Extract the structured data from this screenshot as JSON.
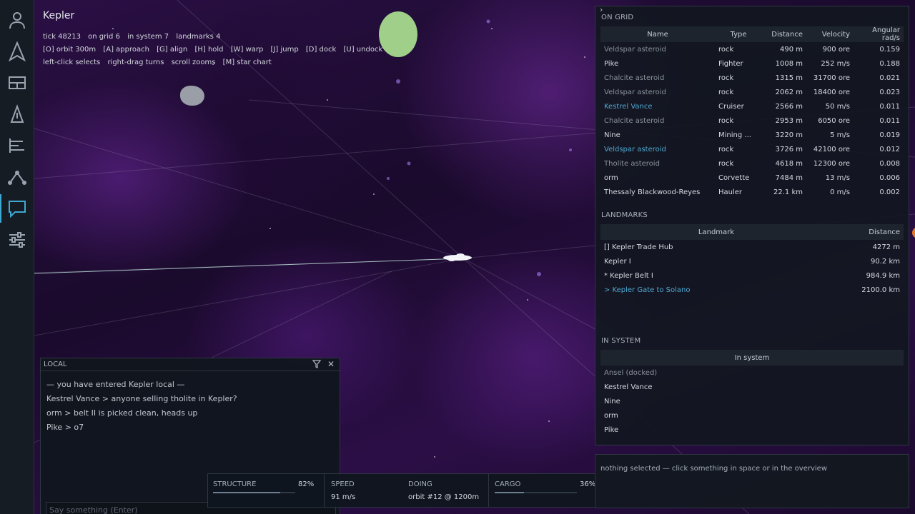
{
  "hud": {
    "title": "Kepler",
    "stats": [
      "tick 48213",
      "on grid 6",
      "in system 7",
      "landmarks 4"
    ],
    "hotkeys": [
      "[O] orbit 300m",
      "[A] approach",
      "[G] align",
      "[H] hold",
      "[W] warp",
      "[J] jump",
      "[D] dock",
      "[U] undock"
    ],
    "help": [
      "left-click selects",
      "right-drag turns",
      "scroll zooms",
      "[M] star chart"
    ]
  },
  "nav": {
    "items": [
      {
        "icon": "character-icon",
        "active": false
      },
      {
        "icon": "ship-icon",
        "active": false
      },
      {
        "icon": "inventory-icon",
        "active": false
      },
      {
        "icon": "fitting-icon",
        "active": false
      },
      {
        "icon": "overview-icon",
        "active": false
      },
      {
        "icon": "map-icon",
        "active": false
      },
      {
        "icon": "chat-icon",
        "active": true
      },
      {
        "icon": "settings-icon",
        "active": false
      }
    ],
    "accent": "#3fa8d0"
  },
  "overview": {
    "chevron": "›",
    "on_grid": {
      "title": "ON GRID",
      "columns": [
        "Name",
        "Type",
        "Distance",
        "Velocity",
        "Angular rad/s"
      ],
      "rows": [
        {
          "name": "Veldspar asteroid",
          "type": "rock",
          "distance": "490 m",
          "velocity": "900 ore",
          "angular": "0.159",
          "style": "dim"
        },
        {
          "name": "Pike",
          "type": "Fighter",
          "distance": "1008 m",
          "velocity": "252 m/s",
          "angular": "0.188",
          "style": ""
        },
        {
          "name": "Chalcite asteroid",
          "type": "rock",
          "distance": "1315 m",
          "velocity": "31700 ore",
          "angular": "0.021",
          "style": "dim"
        },
        {
          "name": "Veldspar asteroid",
          "type": "rock",
          "distance": "2062 m",
          "velocity": "18400 ore",
          "angular": "0.023",
          "style": "dim"
        },
        {
          "name": "Kestrel Vance",
          "type": "Cruiser",
          "distance": "2566 m",
          "velocity": "50 m/s",
          "angular": "0.011",
          "style": "hl"
        },
        {
          "name": "Chalcite asteroid",
          "type": "rock",
          "distance": "2953 m",
          "velocity": "6050 ore",
          "angular": "0.011",
          "style": "dim"
        },
        {
          "name": "Nine",
          "type": "Mining ...",
          "distance": "3220 m",
          "velocity": "5 m/s",
          "angular": "0.019",
          "style": ""
        },
        {
          "name": "Veldspar asteroid",
          "type": "rock",
          "distance": "3726 m",
          "velocity": "42100 ore",
          "angular": "0.012",
          "style": "hl"
        },
        {
          "name": "Tholite asteroid",
          "type": "rock",
          "distance": "4618 m",
          "velocity": "12300 ore",
          "angular": "0.008",
          "style": "dim"
        },
        {
          "name": "orm",
          "type": "Corvette",
          "distance": "7484 m",
          "velocity": "13 m/s",
          "angular": "0.006",
          "style": ""
        },
        {
          "name": "Thessaly Blackwood-Reyes",
          "type": "Hauler",
          "distance": "22.1 km",
          "velocity": "0 m/s",
          "angular": "0.002",
          "style": ""
        }
      ]
    },
    "landmarks": {
      "title": "LANDMARKS",
      "columns": [
        "Landmark",
        "Distance"
      ],
      "rows": [
        {
          "name": "[] Kepler Trade Hub",
          "distance": "4272 m",
          "style": ""
        },
        {
          "name": "Kepler I",
          "distance": "90.2 km",
          "style": ""
        },
        {
          "name": "* Kepler Belt I",
          "distance": "984.9 km",
          "style": ""
        },
        {
          "name": "> Kepler Gate to Solano",
          "distance": "2100.0 km",
          "style": "hl"
        }
      ]
    },
    "in_system": {
      "title": "IN SYSTEM",
      "column": "In system",
      "rows": [
        {
          "name": "Ansel (docked)",
          "style": "dim"
        },
        {
          "name": "Kestrel Vance",
          "style": ""
        },
        {
          "name": "Nine",
          "style": ""
        },
        {
          "name": "orm",
          "style": ""
        },
        {
          "name": "Pike",
          "style": ""
        }
      ]
    }
  },
  "chat": {
    "title": "LOCAL",
    "close": "✕",
    "messages": [
      "— you have entered Kepler local —",
      "Kestrel Vance > anyone selling tholite in Kepler?",
      "orm > belt II is picked clean, heads up",
      "Pike > o7"
    ],
    "placeholder": "Say something (Enter)"
  },
  "status": {
    "structure_label": "STRUCTURE",
    "structure_pct": "82%",
    "structure_value": 0.82,
    "speed_label": "SPEED",
    "speed_value": "91 m/s",
    "doing_label": "DOING",
    "doing_value": "orbit #12 @ 1200m",
    "cargo_label": "CARGO",
    "cargo_pct": "36%",
    "cargo_value": 0.36
  },
  "selection": {
    "text": "nothing selected — click something in space or in the overview"
  },
  "colors": {
    "planet_green": "#9fcf88",
    "planet_grey": "#9a9ea6",
    "accent": "#4fa7d0",
    "alert": "#e0762a"
  }
}
